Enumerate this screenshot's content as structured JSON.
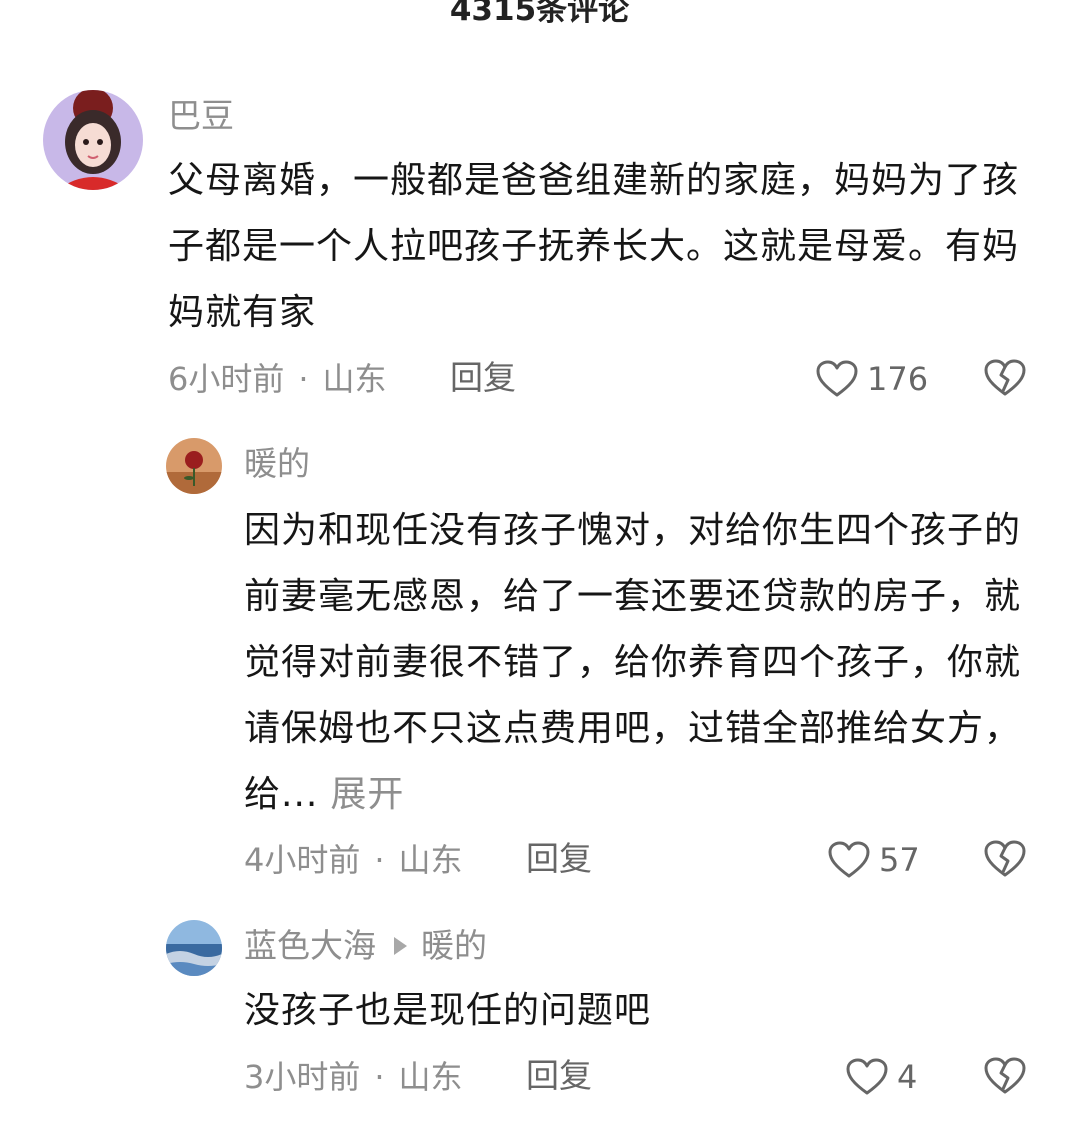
{
  "header": {
    "title": "4315条评论"
  },
  "comments": [
    {
      "username": "巴豆",
      "text": "父母离婚，一般都是爸爸组建新的家庭，妈妈为了孩子都是一个人拉吧孩子抚养长大。这就是母爱。有妈妈就有家",
      "time": "6小时前",
      "location": "山东",
      "reply_label": "回复",
      "likes": "176",
      "avatar_icon": "girl-avatar"
    },
    {
      "username": "暖的",
      "text": "因为和现任没有孩子愧对，对给你生四个孩子的前妻毫无感恩，给了一套还要还贷款的房子，就觉得对前妻很不错了，给你养育四个孩子，你就请保姆也不只这点费用吧，过错全部推给女方，给...",
      "expand_label": "展开",
      "time": "4小时前",
      "location": "山东",
      "reply_label": "回复",
      "likes": "57",
      "avatar_icon": "rose-avatar"
    },
    {
      "username": "蓝色大海",
      "reply_to": "暖的",
      "text": "没孩子也是现任的问题吧",
      "time": "3小时前",
      "location": "山东",
      "reply_label": "回复",
      "likes": "4",
      "avatar_icon": "sea-avatar"
    }
  ],
  "separator": "·",
  "colors": {
    "text": "#161616",
    "meta": "#8e8e8e",
    "icon": "#666666"
  }
}
